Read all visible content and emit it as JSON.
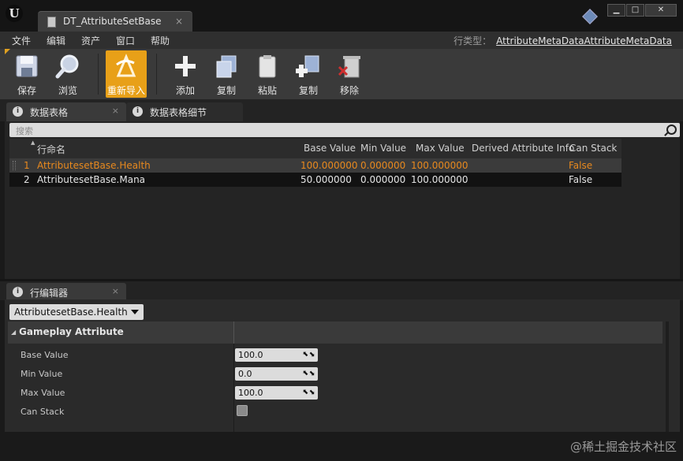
{
  "window": {
    "tab_label": "DT_AttributeSetBase",
    "tab_close": "×",
    "logo_text": "U",
    "buttons": {
      "minimize": "▁",
      "maximize": "□",
      "close": "✕"
    }
  },
  "menu": {
    "items": [
      "文件",
      "编辑",
      "资产",
      "窗口",
      "帮助"
    ],
    "parent_label": "行类型：",
    "parent_value": "AttributeMetaDataAttributeMetaData"
  },
  "toolbar": {
    "buttons": [
      {
        "label": "保存",
        "icon": "save-icon"
      },
      {
        "label": "浏览",
        "icon": "browse-icon"
      },
      {
        "label": "重新导入",
        "icon": "reimport-icon",
        "active": true
      },
      {
        "label": "添加",
        "icon": "add-icon"
      },
      {
        "label": "复制",
        "icon": "copy-icon"
      },
      {
        "label": "粘贴",
        "icon": "paste-icon"
      },
      {
        "label": "复制",
        "icon": "duplicate-icon"
      },
      {
        "label": "移除",
        "icon": "remove-icon"
      }
    ]
  },
  "panels": {
    "data_table_tab": "数据表格",
    "details_tab": "数据表格细节",
    "row_editor_tab": "行编辑器",
    "close": "×"
  },
  "table": {
    "search_placeholder": "搜索",
    "columns": [
      "行命名",
      "Base Value",
      "Min Value",
      "Max Value",
      "Derived Attribute Info",
      "Can Stack"
    ],
    "rows": [
      {
        "index": "1",
        "name": "AttributesetBase.Health",
        "base": "100.000000",
        "min": "0.000000",
        "max": "100.000000",
        "derived": "",
        "stack": "False",
        "selected": true
      },
      {
        "index": "2",
        "name": "AttributesetBase.Mana",
        "base": "50.000000",
        "min": "0.000000",
        "max": "100.000000",
        "derived": "",
        "stack": "False",
        "selected": false
      }
    ]
  },
  "editor": {
    "selected_row": "AttributesetBase.Health",
    "category": "Gameplay Attribute",
    "props": [
      {
        "label": "Base Value",
        "value": "100.0"
      },
      {
        "label": "Min Value",
        "value": "0.0"
      },
      {
        "label": "Max Value",
        "value": "100.0"
      }
    ],
    "can_stack_label": "Can Stack",
    "can_stack_checked": false
  },
  "watermark": "@稀土掘金技术社区",
  "colors": {
    "accent": "#e8a018",
    "selected_text": "#e8891e"
  }
}
